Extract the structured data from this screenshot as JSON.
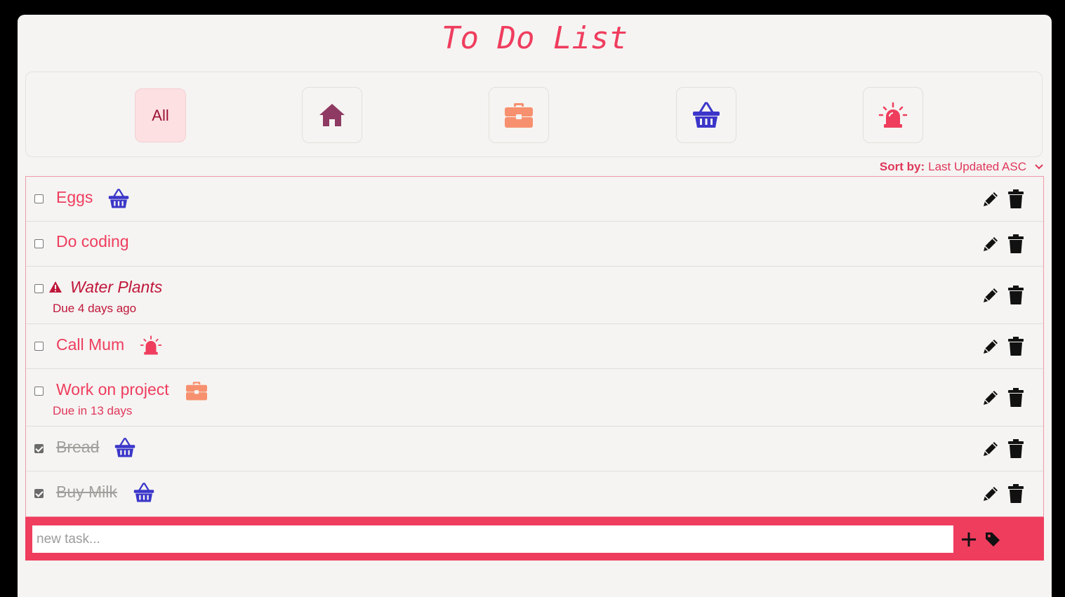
{
  "app": {
    "title": "To Do List"
  },
  "filters": [
    {
      "label": "All",
      "icon": null,
      "active": true
    },
    {
      "label": "",
      "icon": "home-icon",
      "color": "#8e3a63"
    },
    {
      "label": "",
      "icon": "briefcase-icon",
      "color": "#f7906e"
    },
    {
      "label": "",
      "icon": "basket-icon",
      "color": "#3b36c9"
    },
    {
      "label": "",
      "icon": "alarm-icon",
      "color": "#ef3d5e"
    }
  ],
  "sort": {
    "label": "Sort by:",
    "value": "Last Updated ASC"
  },
  "tasks": [
    {
      "text": "Eggs",
      "tag": "basket-icon",
      "done": false,
      "due": ""
    },
    {
      "text": "Do coding",
      "tag": "",
      "done": false,
      "due": ""
    },
    {
      "text": "Water Plants",
      "tag": "",
      "done": false,
      "overdue": true,
      "due": "Due 4 days ago"
    },
    {
      "text": "Call Mum",
      "tag": "alarm-icon",
      "done": false,
      "due": ""
    },
    {
      "text": "Work on project",
      "tag": "briefcase-icon",
      "done": false,
      "due": "Due in 13 days"
    },
    {
      "text": "Bread",
      "tag": "basket-icon",
      "done": true,
      "due": ""
    },
    {
      "text": "Buy Milk",
      "tag": "basket-icon",
      "done": true,
      "due": ""
    }
  ],
  "new_task": {
    "placeholder": "new task..."
  },
  "colors": {
    "accent": "#ef3d5e",
    "background": "#f5f4f2",
    "overdue": "#c0163a"
  }
}
